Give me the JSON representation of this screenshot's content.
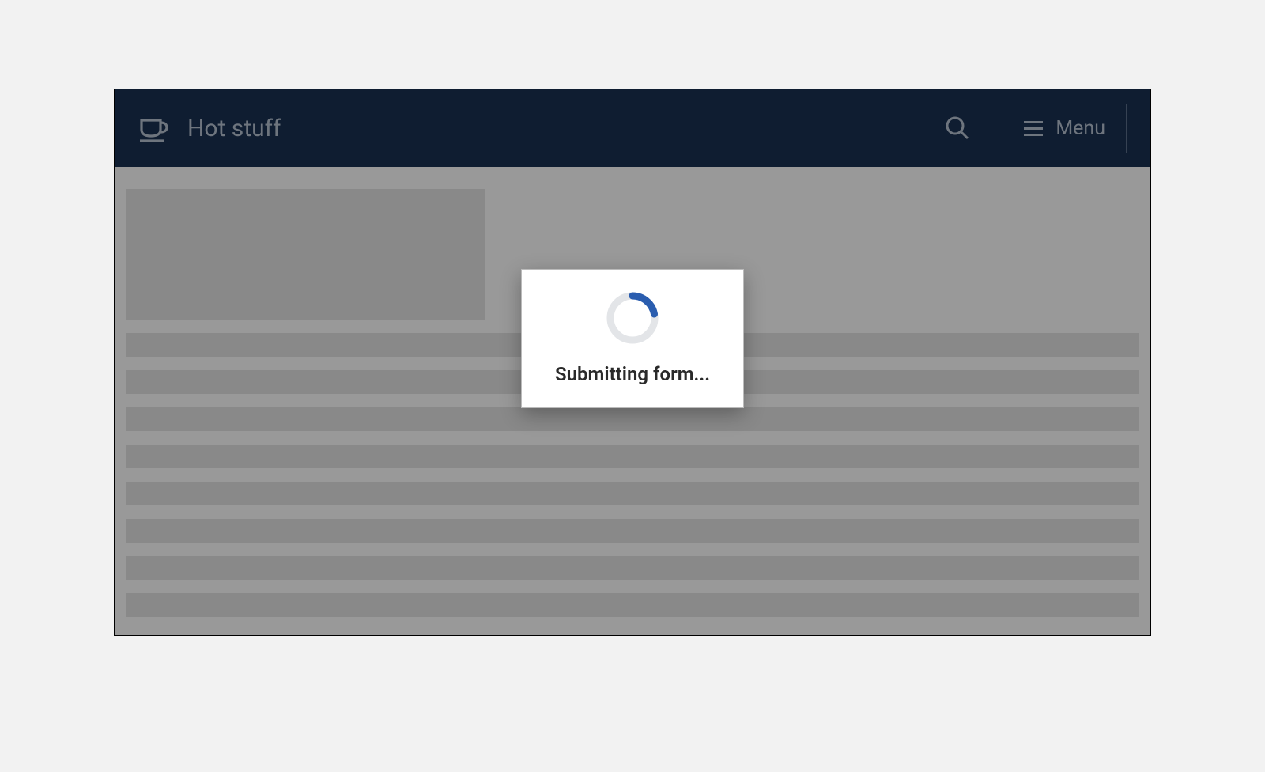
{
  "header": {
    "brand_title": "Hot stuff",
    "menu_label": "Menu"
  },
  "modal": {
    "message": "Submitting form..."
  },
  "colors": {
    "header_bg": "#1a3152",
    "header_text": "#b8c4d3",
    "spinner_track": "#e3e5e8",
    "spinner_active": "#2a5daf",
    "skeleton": "#e5e5e5"
  }
}
